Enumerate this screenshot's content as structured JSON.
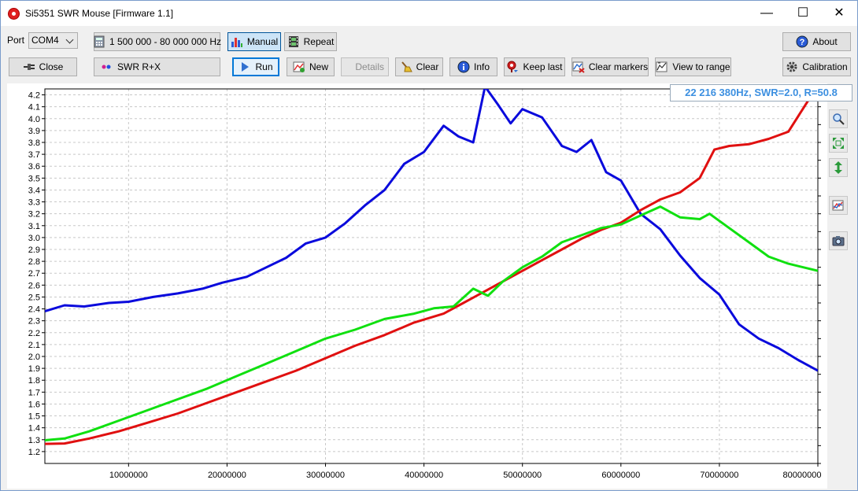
{
  "window": {
    "title": "Si5351 SWR Mouse [Firmware 1.1]"
  },
  "toolbar": {
    "port_label": "Port",
    "port_value": "COM4",
    "range_label": "1 500 000 - 80 000 000 Hz",
    "manual_label": "Manual",
    "repeat_label": "Repeat",
    "about_label": "About",
    "close_label": "Close",
    "mode_label": "SWR R+X",
    "run_label": "Run",
    "new_label": "New",
    "details_label": "Details",
    "clear_label": "Clear",
    "info_label": "Info",
    "keep_last_label": "Keep last",
    "clear_markers_label": "Clear markers",
    "view_to_range_label": "View to range",
    "calibration_label": "Calibration"
  },
  "marker_readout": "22 216 380Hz, SWR=2.0, R=50.8",
  "colors": {
    "swr": "#0a0adc",
    "r": "#e01010",
    "x": "#10e010",
    "marker_text": "#3c8fe0"
  },
  "chart_data": {
    "type": "line",
    "x_ticks": [
      "10000000",
      "20000000",
      "30000000",
      "40000000",
      "50000000",
      "60000000",
      "70000000",
      "80000000"
    ],
    "xlim": [
      1500000,
      80000000
    ],
    "ylim_left": [
      1.1,
      4.25
    ],
    "ylim_right": [
      0,
      105
    ],
    "y_left_ticks": [
      "1.2",
      "1.3",
      "1.4",
      "1.5",
      "1.6",
      "1.7",
      "1.8",
      "1.9",
      "2.0",
      "2.1",
      "2.2",
      "2.3",
      "2.4",
      "2.5",
      "2.6",
      "2.7",
      "2.8",
      "2.9",
      "3.0",
      "3.1",
      "3.2",
      "3.3",
      "3.4",
      "3.5",
      "3.6",
      "3.7",
      "3.8",
      "3.9",
      "4.0",
      "4.1",
      "4.2"
    ],
    "y_right_ticks": [
      "0",
      "5",
      "10",
      "15",
      "20",
      "25",
      "30",
      "35",
      "40",
      "45",
      "50",
      "55",
      "60",
      "65",
      "70",
      "75",
      "80",
      "85",
      "90",
      "95",
      "100",
      "105"
    ],
    "grid": true,
    "series": [
      {
        "axis": "left",
        "color": "#0a0adc",
        "x": [
          1500000,
          3500000,
          5500000,
          8000000,
          10000000,
          12500000,
          15000000,
          17500000,
          19500000,
          22000000,
          24000000,
          26000000,
          28000000,
          30000000,
          32000000,
          34000000,
          36000000,
          38000000,
          40000000,
          42000000,
          43500000,
          45000000,
          46200000,
          47500000,
          48800000,
          50000000,
          52000000,
          54000000,
          55500000,
          57000000,
          58500000,
          60000000,
          62000000,
          64000000,
          66000000,
          68000000,
          70000000,
          72000000,
          74000000,
          76000000,
          78000000,
          80000000
        ],
        "y": [
          2.38,
          2.43,
          2.42,
          2.45,
          2.46,
          2.5,
          2.53,
          2.57,
          2.62,
          2.67,
          2.75,
          2.83,
          2.95,
          3.0,
          3.12,
          3.27,
          3.4,
          3.62,
          3.72,
          3.94,
          3.85,
          3.8,
          4.27,
          4.12,
          3.96,
          4.08,
          4.01,
          3.77,
          3.72,
          3.82,
          3.55,
          3.48,
          3.2,
          3.07,
          2.85,
          2.66,
          2.52,
          2.27,
          2.15,
          2.07,
          1.97,
          1.88
        ]
      },
      {
        "axis": "right",
        "color": "#e01010",
        "x": [
          1500000,
          3500000,
          6000000,
          9000000,
          12000000,
          15000000,
          18000000,
          21000000,
          24000000,
          27000000,
          30000000,
          33000000,
          36000000,
          39000000,
          42000000,
          44000000,
          46000000,
          48000000,
          50000000,
          52000000,
          54000000,
          56000000,
          58000000,
          60000000,
          62000000,
          64000000,
          66000000,
          68000000,
          69500000,
          71000000,
          73000000,
          75000000,
          77000000,
          80000000
        ],
        "y": [
          5.5,
          5.6,
          7,
          9,
          11.5,
          14,
          17,
          20,
          23,
          26,
          29.5,
          33,
          36,
          39.5,
          42,
          45,
          48,
          51,
          54,
          57,
          60,
          63,
          65.5,
          67.5,
          71,
          74,
          76,
          80,
          88,
          89,
          89.5,
          91,
          93,
          106
        ]
      },
      {
        "axis": "right",
        "color": "#10e010",
        "x": [
          1500000,
          3500000,
          6000000,
          9000000,
          12000000,
          15000000,
          18000000,
          21000000,
          24000000,
          27000000,
          30000000,
          33000000,
          36000000,
          39000000,
          41000000,
          43000000,
          45000000,
          46500000,
          48000000,
          50000000,
          52000000,
          54000000,
          56000000,
          58000000,
          60000000,
          62000000,
          64000000,
          66000000,
          68000000,
          69000000,
          71000000,
          73000000,
          75000000,
          77000000,
          80000000
        ],
        "y": [
          6.5,
          7,
          9,
          12,
          15,
          18,
          21,
          24.5,
          28,
          31.5,
          35,
          37.5,
          40.5,
          42,
          43.5,
          44,
          49,
          47,
          51,
          55,
          58,
          62,
          64,
          66,
          67,
          69.5,
          72,
          69,
          68.5,
          70,
          66,
          62,
          58,
          56,
          54
        ]
      }
    ]
  }
}
